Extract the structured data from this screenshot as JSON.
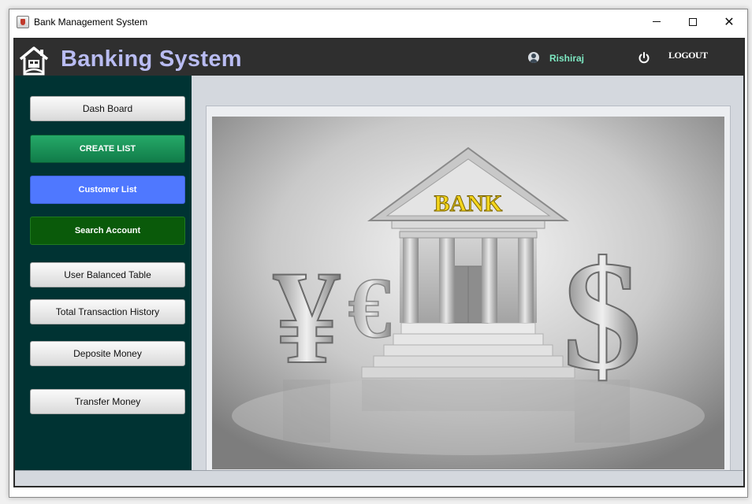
{
  "window": {
    "title": "Bank Management System",
    "controls": {
      "minimize": "",
      "maximize": "",
      "close": "✕"
    }
  },
  "header": {
    "title": "Banking System",
    "user": "Rishiraj",
    "logout_label": "LOGOUT"
  },
  "sidebar": {
    "buttons": [
      {
        "label": "Dash Board"
      },
      {
        "label": "CREATE LIST"
      },
      {
        "label": "Customer List"
      },
      {
        "label": "Search Account"
      },
      {
        "label": "User Balanced Table"
      },
      {
        "label": "Total Transaction History"
      },
      {
        "label": "Deposite Money"
      },
      {
        "label": "Transfer Money"
      }
    ]
  },
  "main": {
    "image": {
      "sign_text": "BANK",
      "yen": "¥",
      "euro": "€",
      "dollar": "$"
    }
  },
  "colors": {
    "header_bg": "#2f2f2f",
    "sidebar_bg": "#003333",
    "title_color": "#b9bcf2",
    "username_color": "#7de8c2",
    "create_button": "#1a9457",
    "customer_button": "#4f78ff",
    "search_button": "#0a5a0a"
  }
}
